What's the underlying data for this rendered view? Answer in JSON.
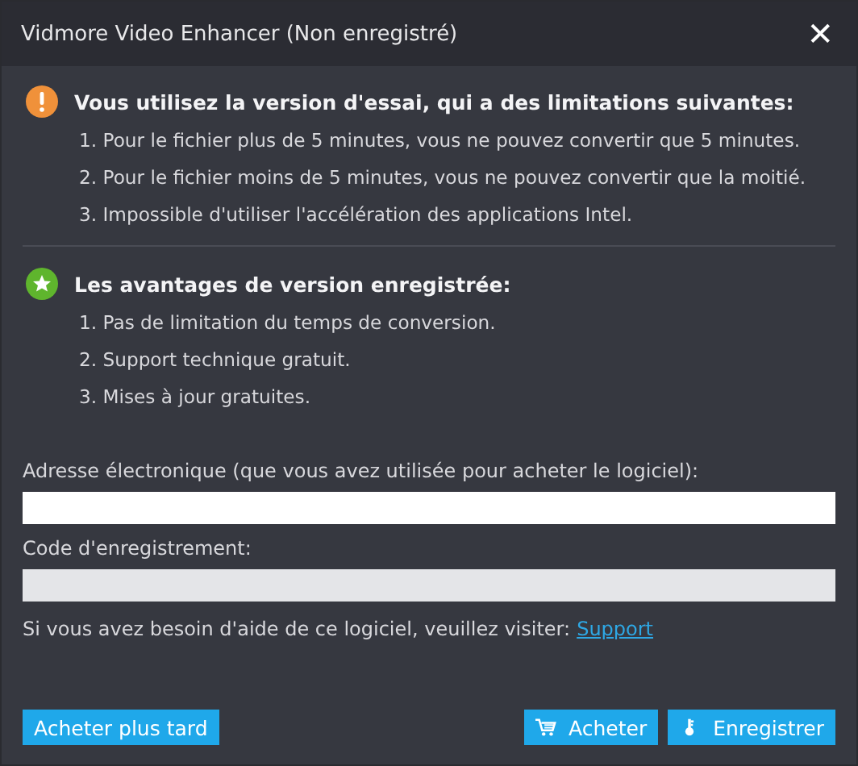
{
  "window": {
    "title": "Vidmore Video Enhancer (Non enregistré)",
    "close": "✕"
  },
  "sections": [
    {
      "kind": "warning",
      "heading": "Vous utilisez la version d'essai, qui a des limitations suivantes:",
      "items": [
        "1.  Pour le fichier plus de 5 minutes, vous ne pouvez convertir que 5 minutes.",
        "2.  Pour le fichier moins de 5 minutes, vous ne pouvez convertir que la moitié.",
        "3.  Impossible d'utiliser l'accélération des applications Intel."
      ]
    },
    {
      "kind": "benefit",
      "heading": "Les avantages de version enregistrée:",
      "items": [
        "1. Pas de limitation du temps de conversion.",
        "2. Support technique gratuit.",
        "3. Mises à jour gratuites."
      ]
    }
  ],
  "fields": [
    {
      "label": "Adresse électronique (que vous avez utilisée pour acheter le logiciel):",
      "focused": true
    },
    {
      "label": "Code d'enregistrement:",
      "focused": false
    }
  ],
  "help": {
    "text": "Si vous avez besoin d'aide de ce logiciel, veuillez visiter:",
    "link": "Support"
  },
  "buttons": [
    {
      "kind": "plain",
      "label": "Acheter plus tard"
    },
    {
      "kind": "cart",
      "label": "Acheter"
    },
    {
      "kind": "key",
      "label": "Enregistrer"
    }
  ]
}
